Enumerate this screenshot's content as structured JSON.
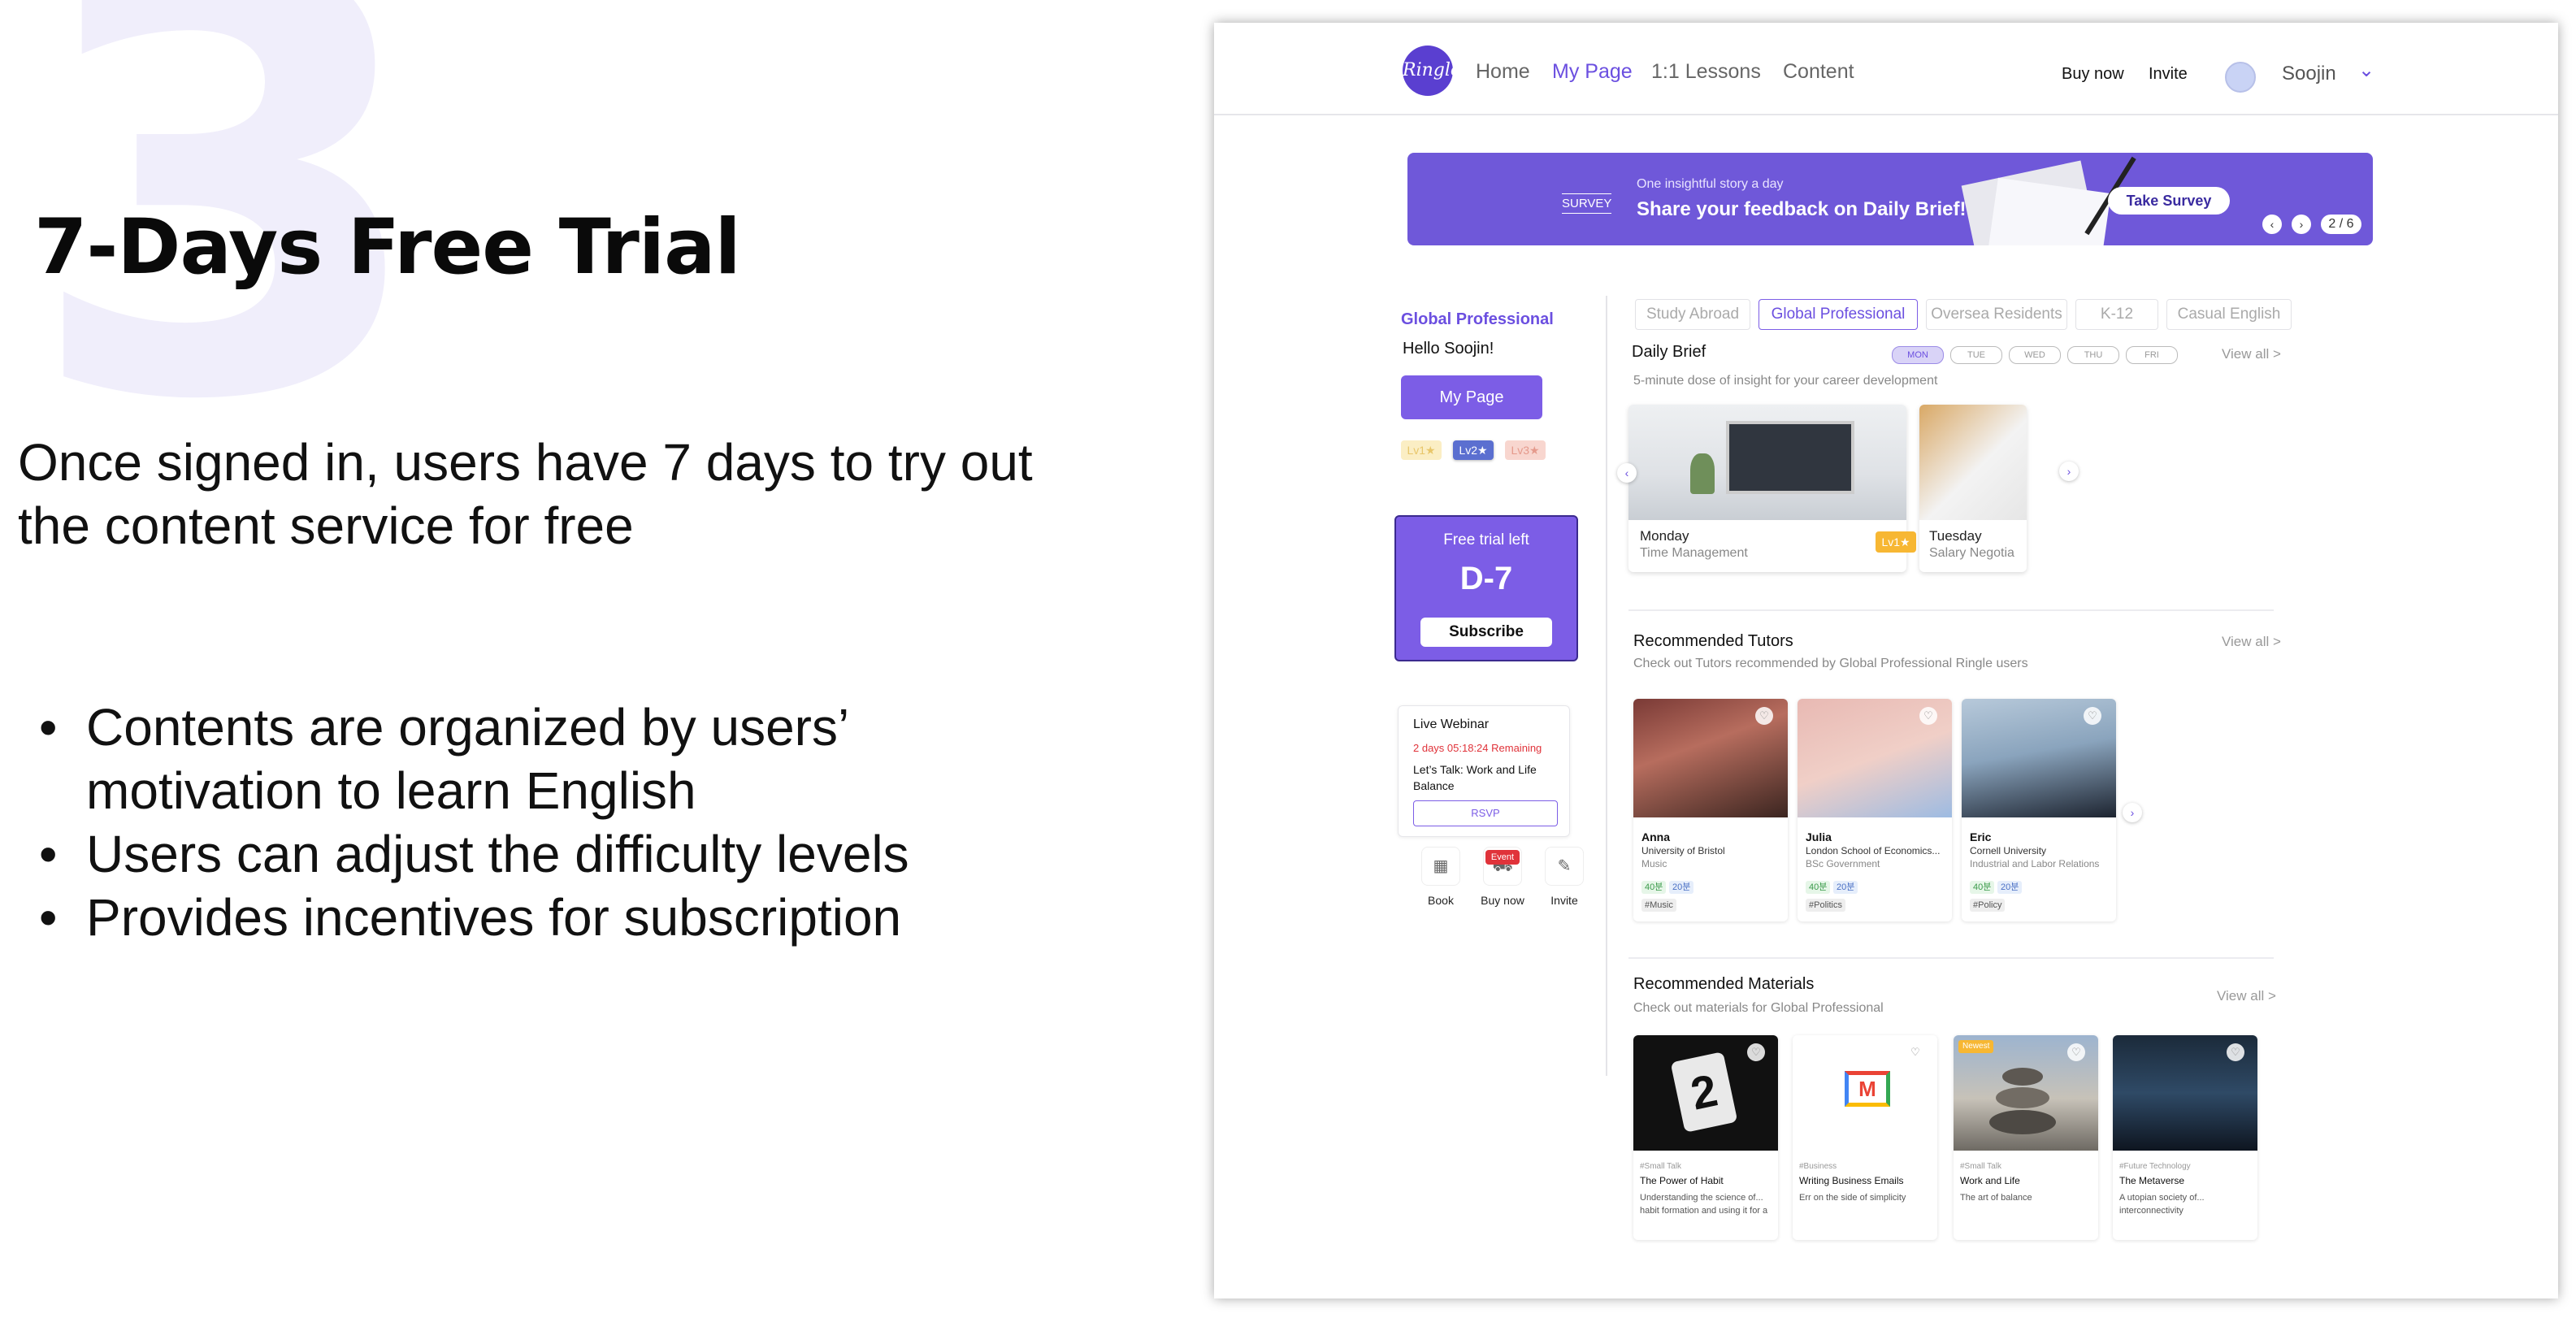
{
  "slide": {
    "number": "3",
    "title": "7-Days Free Trial",
    "description": "Once signed in, users have 7 days to try out the content service for free",
    "bullets": [
      "Contents are organized by users’ motivation to learn English",
      "Users can adjust the difficulty levels",
      "Provides incentives for subscription"
    ]
  },
  "nav": {
    "logo": "Ringle",
    "links": [
      "Home",
      "My Page",
      "1:1 Lessons",
      "Content"
    ],
    "active_link": "My Page",
    "buy_now": "Buy now",
    "invite": "Invite",
    "user": "Soojin"
  },
  "banner": {
    "tag": "SURVEY",
    "small_text": "One insightful story a day",
    "headline": "Share your feedback on Daily Brief!",
    "button": "Take Survey",
    "pager": "2 / 6",
    "color": "#6f58d9"
  },
  "sidebar": {
    "track": "Global Professional",
    "greeting": "Hello Soojin!",
    "mypage_button": "My Page",
    "levels": [
      "Lv1★",
      "Lv2★",
      "Lv3★"
    ],
    "active_level": "Lv2★",
    "trial": {
      "label": "Free trial left",
      "days": "D-7",
      "button": "Subscribe"
    },
    "webinar": {
      "title": "Live Webinar",
      "remaining": "2 days 05:18:24 Remaining",
      "topic": "Let’s Talk: Work and Life Balance",
      "button": "RSVP"
    },
    "quick_actions": [
      {
        "label": "Book",
        "icon": "calendar-icon"
      },
      {
        "label": "Buy now",
        "icon": "cart-icon",
        "badge": "Event"
      },
      {
        "label": "Invite",
        "icon": "megaphone-icon"
      }
    ]
  },
  "tabs": {
    "items": [
      "Study Abroad",
      "Global Professional",
      "Oversea Residents",
      "K-12",
      "Casual English"
    ],
    "active": "Global Professional"
  },
  "daily_brief": {
    "title": "Daily Brief",
    "subtitle": "5-minute dose of insight for your career development",
    "view_all": "View all >",
    "days": [
      "MON",
      "TUE",
      "WED",
      "THU",
      "FRI"
    ],
    "active_day": "MON",
    "cards": [
      {
        "day": "Monday",
        "topic": "Time Management",
        "level": "Lv1★"
      },
      {
        "day": "Tuesday",
        "topic": "Salary Negotia"
      }
    ]
  },
  "tutors": {
    "title": "Recommended Tutors",
    "subtitle": "Check out Tutors recommended by Global Professional Ringle users",
    "view_all": "View all >",
    "items": [
      {
        "name": "Anna",
        "school": "University of Bristol",
        "major": "Music",
        "chips": [
          "40분",
          "20분"
        ],
        "tag": "#Music"
      },
      {
        "name": "Julia",
        "school": "London School of Economics...",
        "major": "BSc Government",
        "chips": [
          "40분",
          "20분"
        ],
        "tag": "#Politics"
      },
      {
        "name": "Eric",
        "school": "Cornell University",
        "major": "Industrial and Labor Relations",
        "chips": [
          "40분",
          "20분"
        ],
        "tag": "#Policy"
      }
    ]
  },
  "materials": {
    "title": "Recommended Materials",
    "subtitle": "Check out materials for Global Professional",
    "view_all": "View all >",
    "items": [
      {
        "tag": "#Small Talk",
        "title": "The Power of Habit",
        "desc": "Understanding the science of... habit formation and using it for a"
      },
      {
        "tag": "#Business",
        "title": "Writing Business Emails",
        "desc": "Err on the side of simplicity"
      },
      {
        "tag": "#Small Talk",
        "title": "Work and Life",
        "desc": "The art of balance",
        "badge": "Newest"
      },
      {
        "tag": "#Future Technology",
        "title": "The Metaverse",
        "desc": "A utopian society of... interconnectivity"
      }
    ]
  },
  "colors": {
    "accent": "#7c5de6",
    "accent_dark": "#6b4fe0",
    "level_badge": "#f7b733"
  }
}
